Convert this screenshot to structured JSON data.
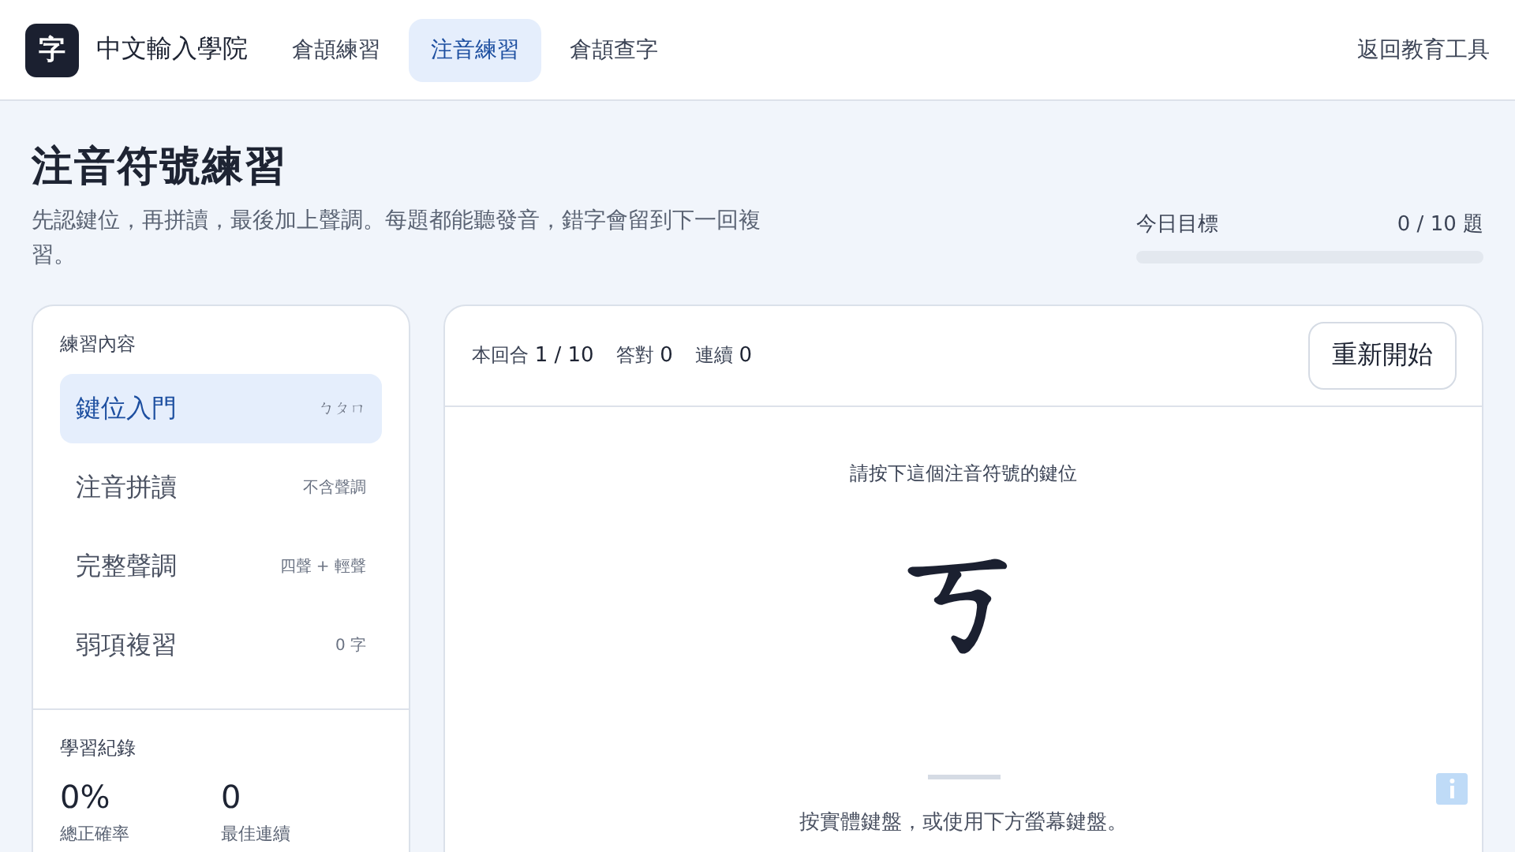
{
  "header": {
    "logo_char": "字",
    "site_name": "中文輸入學院",
    "nav": [
      {
        "label": "倉頡練習",
        "selected": false
      },
      {
        "label": "注音練習",
        "selected": true
      },
      {
        "label": "倉頡查字",
        "selected": false
      }
    ],
    "back_link": "返回教育工具"
  },
  "page": {
    "title": "注音符號練習",
    "subtitle": "先認鍵位，再拼讀，最後加上聲調。每題都能聽發音，錯字會留到下一回複習。",
    "goal": {
      "label": "今日目標",
      "reading": "0 / 10 題",
      "level": 0
    }
  },
  "sidebar": {
    "section_title": "練習內容",
    "items": [
      {
        "label": "鍵位入門",
        "hint": "ㄅㄆㄇ",
        "selected": true
      },
      {
        "label": "注音拼讀",
        "hint": "不含聲調",
        "selected": false
      },
      {
        "label": "完整聲調",
        "hint": "四聲 + 輕聲",
        "selected": false
      },
      {
        "label": "弱項複習",
        "hint": "0 字",
        "selected": false
      }
    ],
    "record_title": "學習紀錄",
    "stats": [
      {
        "value": "0%",
        "label": "總正確率"
      },
      {
        "value": "0",
        "label": "最佳連續"
      }
    ]
  },
  "practice": {
    "stats": [
      {
        "label": "本回合",
        "value": "1 / 10"
      },
      {
        "label": "答對",
        "value": "0"
      },
      {
        "label": "連續",
        "value": "0"
      }
    ],
    "restart_button": "重新開始",
    "prompt": "請按下這個注音符號的鍵位",
    "symbol": "ㄎ",
    "hint": "按實體鍵盤，或使用下方螢幕鍵盤。"
  }
}
